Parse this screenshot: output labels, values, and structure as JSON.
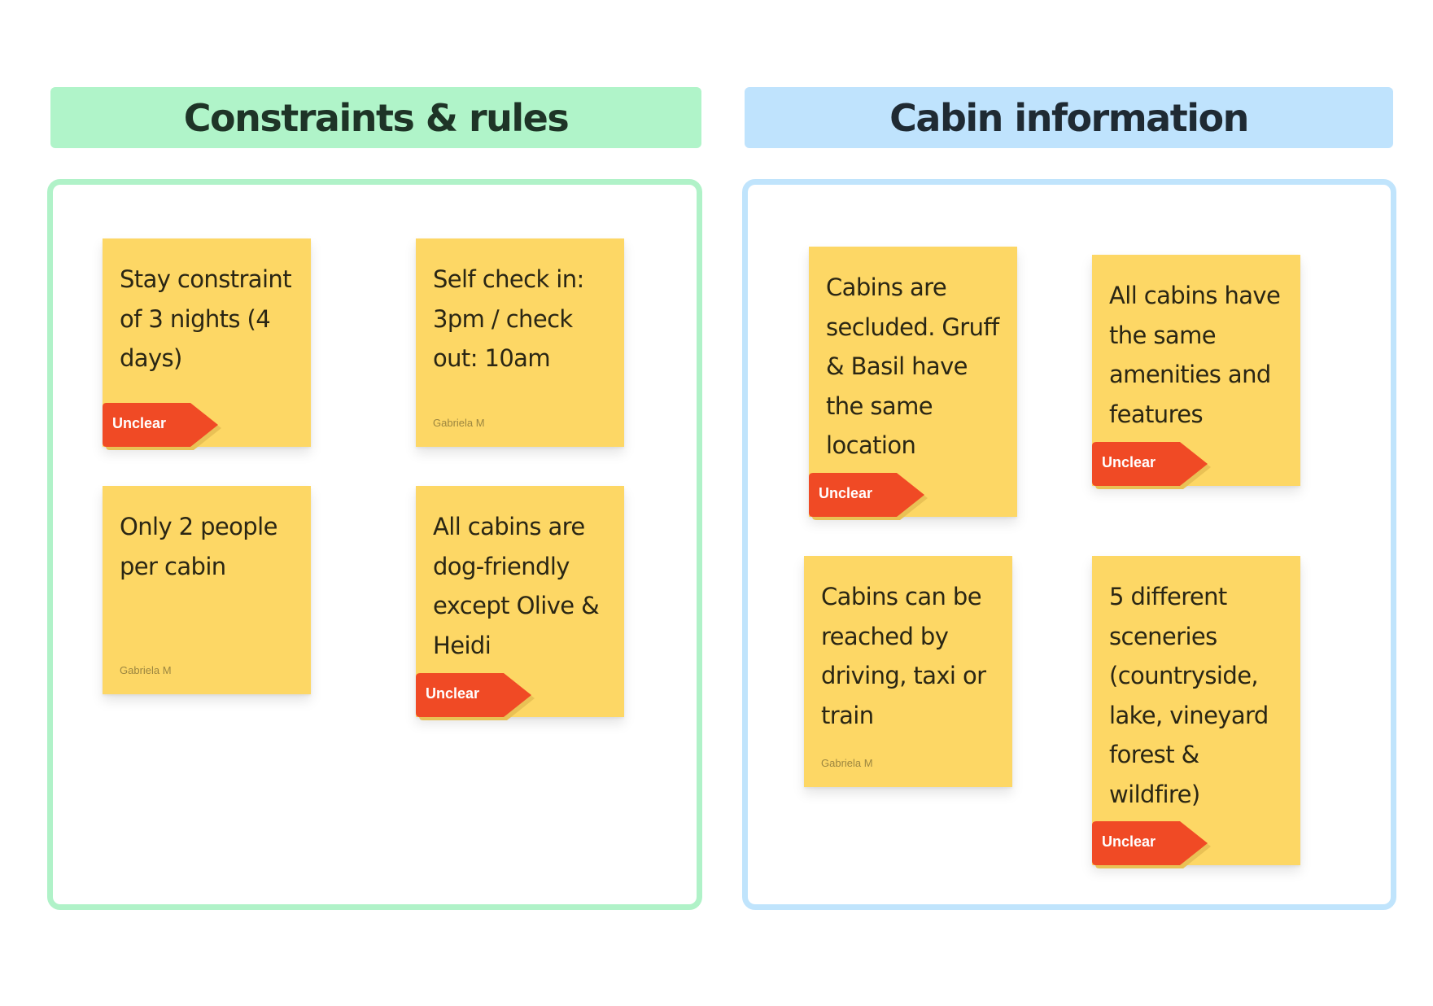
{
  "sections": [
    {
      "title": "Constraints & rules",
      "color": "#b0f4c9",
      "stickies": [
        {
          "text": "Stay constraint of 3 nights (4 days)",
          "tag": "Unclear",
          "author": null
        },
        {
          "text": "Self check in: 3pm / check out: 10am",
          "tag": null,
          "author": "Gabriela M"
        },
        {
          "text": "Only 2 people per cabin",
          "tag": null,
          "author": "Gabriela M"
        },
        {
          "text": "All cabins are dog-friendly except Olive & Heidi",
          "tag": "Unclear",
          "author": null
        }
      ]
    },
    {
      "title": "Cabin information",
      "color": "#bfe3fd",
      "stickies": [
        {
          "text": "Cabins are secluded. Gruff & Basil have the same location",
          "tag": "Unclear",
          "author": null
        },
        {
          "text": "All cabins have the same amenities and features",
          "tag": "Unclear",
          "author": null
        },
        {
          "text": "Cabins can be reached by driving, taxi or train",
          "tag": null,
          "author": "Gabriela M"
        },
        {
          "text": "5 different sceneries (countryside, lake, vineyard forest & wildfire)",
          "tag": "Unclear",
          "author": null
        }
      ]
    }
  ],
  "colors": {
    "sticky": "#fdd765",
    "tag": "#f04a25"
  }
}
